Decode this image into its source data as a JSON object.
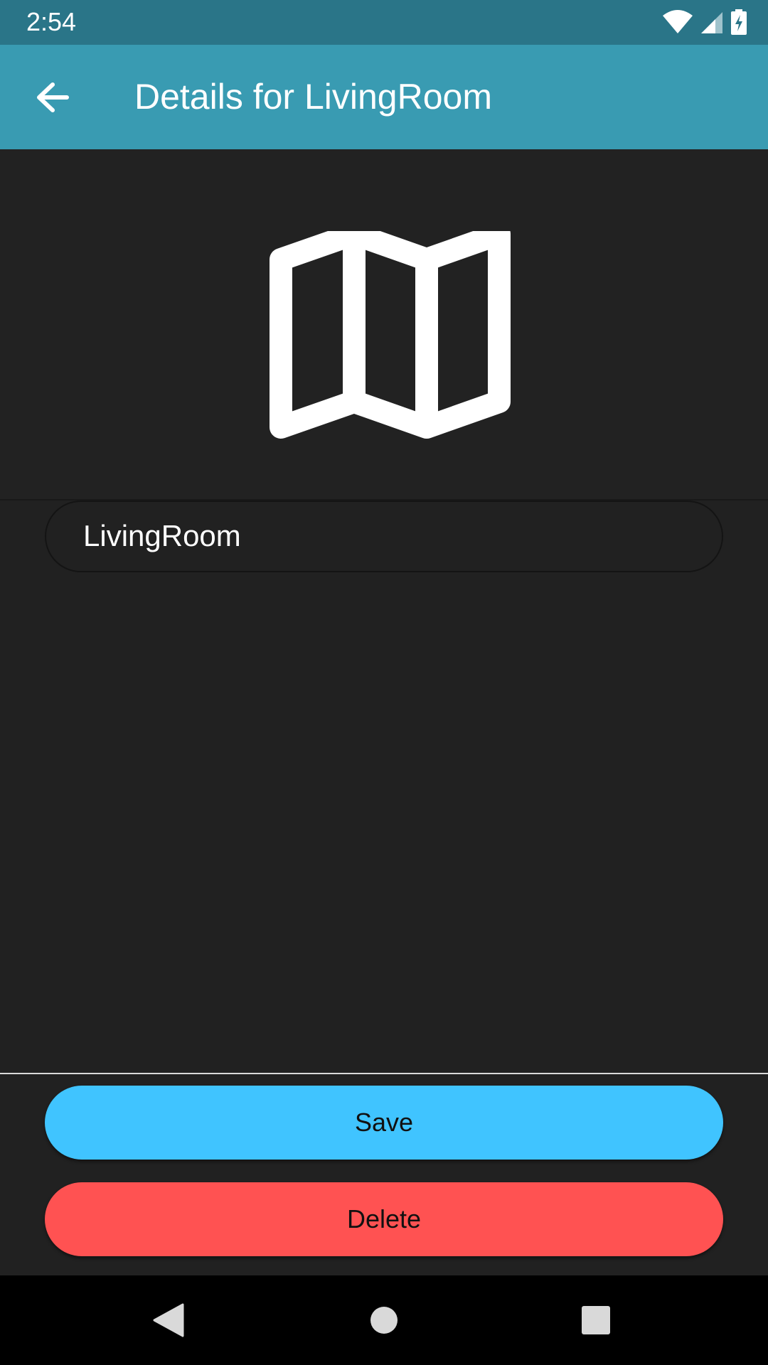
{
  "status_bar": {
    "time": "2:54",
    "icons": [
      "wifi-icon",
      "cell-signal-icon",
      "battery-charging-icon"
    ]
  },
  "app_bar": {
    "title": "Details for LivingRoom",
    "back_icon": "arrow-back-icon",
    "color": "#399BB2"
  },
  "room": {
    "icon": "map-icon",
    "name_value": "LivingRoom"
  },
  "actions": {
    "save_label": "Save",
    "delete_label": "Delete",
    "save_color": "#40C4FF",
    "delete_color": "#FF5252"
  },
  "nav_bar": {
    "buttons": [
      "nav-back-icon",
      "nav-home-icon",
      "nav-recents-icon"
    ]
  }
}
